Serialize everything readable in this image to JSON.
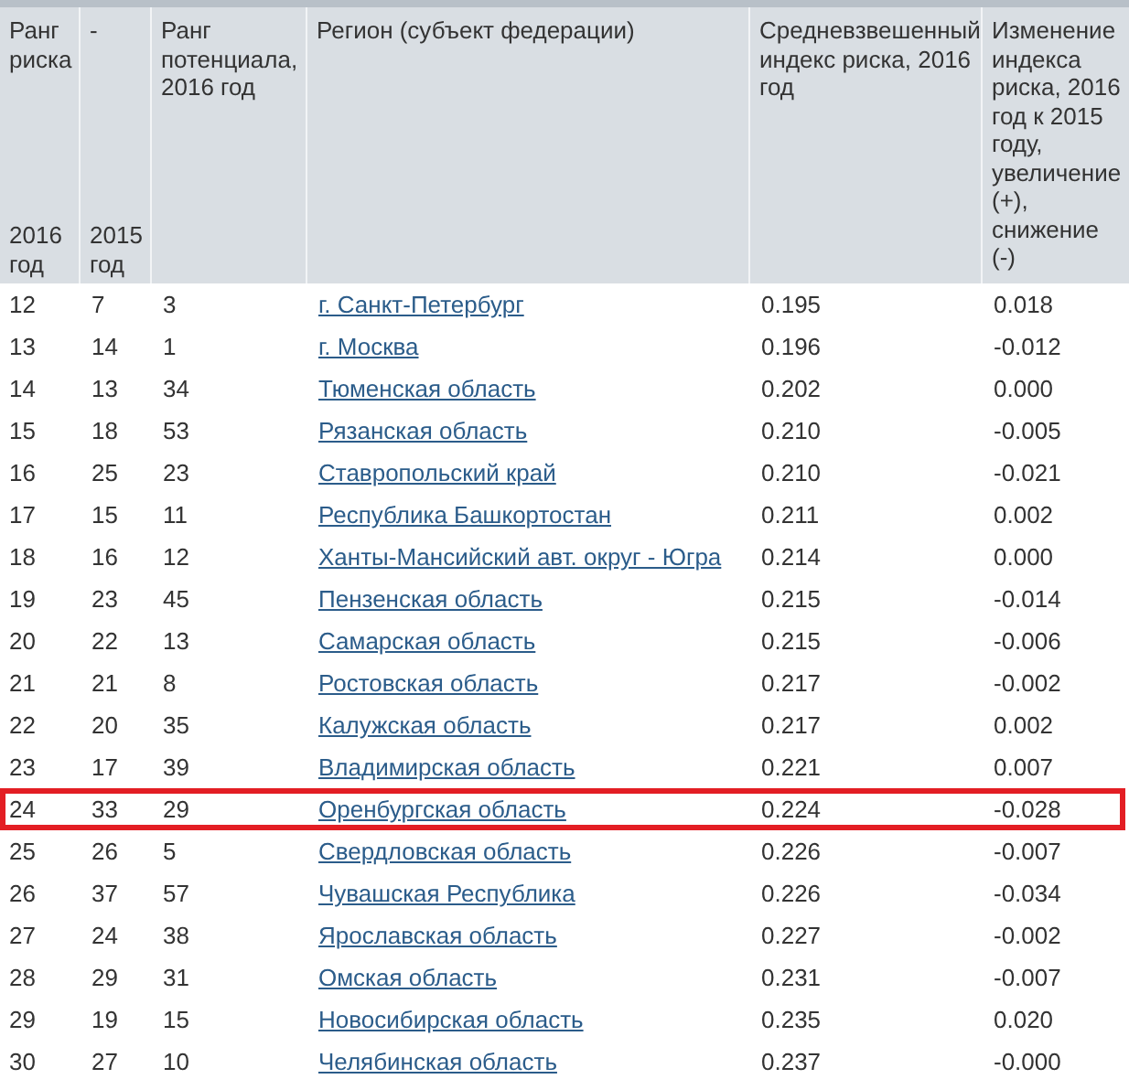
{
  "table": {
    "columns": [
      {
        "top": "Ранг риска",
        "bottom": "2016 год"
      },
      {
        "top": "-",
        "bottom": "2015 год"
      },
      {
        "top": "Ранг потенциала, 2016 год"
      },
      {
        "top": "Регион (субъект федерации)"
      },
      {
        "top": "Средневзвешенный индекс риска, 2016 год"
      },
      {
        "top": "Изменение индекса риска, 2016 год к 2015 году, увеличение (+), снижение (-)"
      }
    ],
    "rows": [
      {
        "cells": [
          "12",
          "7",
          "3",
          "г. Санкт-Петербург",
          "0.195",
          "0.018"
        ],
        "highlighted": false
      },
      {
        "cells": [
          "13",
          "14",
          "1",
          "г. Москва",
          "0.196",
          "-0.012"
        ],
        "highlighted": false
      },
      {
        "cells": [
          "14",
          "13",
          "34",
          "Тюменская область",
          "0.202",
          "0.000"
        ],
        "highlighted": false
      },
      {
        "cells": [
          "15",
          "18",
          "53",
          "Рязанская область",
          "0.210",
          "-0.005"
        ],
        "highlighted": false
      },
      {
        "cells": [
          "16",
          "25",
          "23",
          "Ставропольский край",
          "0.210",
          "-0.021"
        ],
        "highlighted": false
      },
      {
        "cells": [
          "17",
          "15",
          "11",
          "Республика Башкортостан",
          "0.211",
          "0.002"
        ],
        "highlighted": false
      },
      {
        "cells": [
          "18",
          "16",
          "12",
          "Ханты-Мансийский авт. округ - Югра",
          "0.214",
          "0.000"
        ],
        "highlighted": false
      },
      {
        "cells": [
          "19",
          "23",
          "45",
          "Пензенская область",
          "0.215",
          "-0.014"
        ],
        "highlighted": false
      },
      {
        "cells": [
          "20",
          "22",
          "13",
          "Самарская область",
          "0.215",
          "-0.006"
        ],
        "highlighted": false
      },
      {
        "cells": [
          "21",
          "21",
          "8",
          "Ростовская область",
          "0.217",
          "-0.002"
        ],
        "highlighted": false
      },
      {
        "cells": [
          "22",
          "20",
          "35",
          "Калужская область",
          "0.217",
          "0.002"
        ],
        "highlighted": false
      },
      {
        "cells": [
          "23",
          "17",
          "39",
          "Владимирская область",
          "0.221",
          "0.007"
        ],
        "highlighted": false
      },
      {
        "cells": [
          "24",
          "33",
          "29",
          "Оренбургская область",
          "0.224",
          "-0.028"
        ],
        "highlighted": true
      },
      {
        "cells": [
          "25",
          "26",
          "5",
          "Свердловская область",
          "0.226",
          "-0.007"
        ],
        "highlighted": false
      },
      {
        "cells": [
          "26",
          "37",
          "57",
          "Чувашская Республика",
          "0.226",
          "-0.034"
        ],
        "highlighted": false
      },
      {
        "cells": [
          "27",
          "24",
          "38",
          "Ярославская область",
          "0.227",
          "-0.002"
        ],
        "highlighted": false
      },
      {
        "cells": [
          "28",
          "29",
          "31",
          "Омская область",
          "0.231",
          "-0.007"
        ],
        "highlighted": false
      },
      {
        "cells": [
          "29",
          "19",
          "15",
          "Новосибирская область",
          "0.235",
          "0.020"
        ],
        "highlighted": false
      },
      {
        "cells": [
          "30",
          "27",
          "10",
          "Челябинская область",
          "0.237",
          "-0.000"
        ],
        "highlighted": false
      }
    ]
  }
}
